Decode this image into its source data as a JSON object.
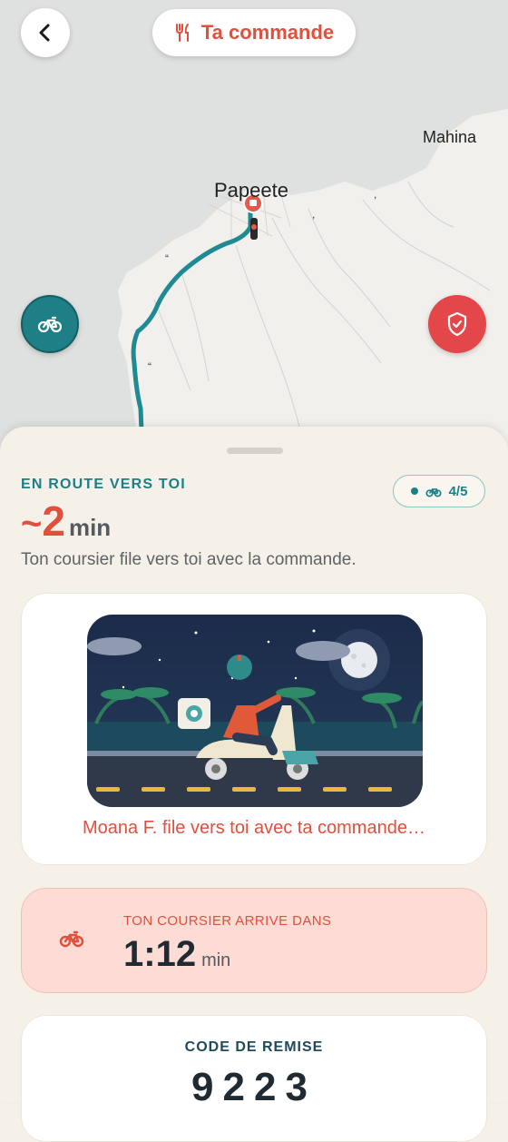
{
  "map": {
    "labels": {
      "papeete": "Papeete",
      "mahina": "Mahina"
    },
    "route_color": "#1e8a94",
    "marker_color": "#e7574b"
  },
  "header": {
    "back_icon": "chevron-left-icon",
    "order_pill": {
      "icon": "utensils-icon",
      "label": "Ta commande"
    }
  },
  "fabs": {
    "bike": {
      "icon": "bike-icon",
      "color": "#1e7f86"
    },
    "safety": {
      "icon": "shield-check-icon",
      "color": "#e3474a"
    }
  },
  "status": {
    "label": "EN ROUTE VERS TOI",
    "eta_prefix": "~",
    "eta_value": "2",
    "eta_unit": "min",
    "subtitle": "Ton coursier file vers toi avec la commande.",
    "progress": {
      "icon": "bike-icon",
      "text": "4/5",
      "current": 4,
      "total": 5
    }
  },
  "illustration": {
    "caption": "Moana F. file vers toi avec ta commande…"
  },
  "courier": {
    "icon": "bike-icon",
    "label": "TON COURSIER ARRIVE DANS",
    "value": "1:12",
    "unit": "min"
  },
  "discount": {
    "label": "CODE DE REMISE",
    "code": "9223"
  },
  "colors": {
    "accent_red": "#e14f3d",
    "accent_teal": "#1b7f86",
    "sheet_bg": "#f6f1e8"
  }
}
